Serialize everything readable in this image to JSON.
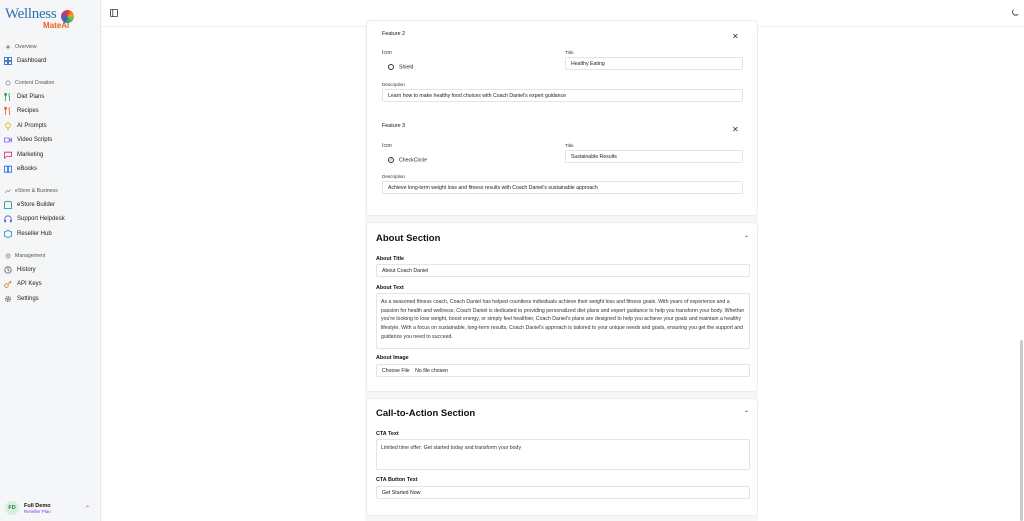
{
  "brand": {
    "name_top": "Wellness",
    "name_bottom": "MateAI"
  },
  "sidebar": {
    "sections": [
      {
        "label": "Overview",
        "items": [
          {
            "label": "Dashboard",
            "icon": "dashboard-icon",
            "color": "#2b6fb5"
          }
        ]
      },
      {
        "label": "Content Creation",
        "items": [
          {
            "label": "Diet Plans",
            "icon": "utensils-icon",
            "color": "#2ea043"
          },
          {
            "label": "Recipes",
            "icon": "chef-icon",
            "color": "#e8641b"
          },
          {
            "label": "AI Prompts",
            "icon": "bulb-icon",
            "color": "#e0b000"
          },
          {
            "label": "Video Scripts",
            "icon": "video-icon",
            "color": "#8b5cf6"
          },
          {
            "label": "Marketing",
            "icon": "message-icon",
            "color": "#db2777"
          },
          {
            "label": "eBooks",
            "icon": "book-icon",
            "color": "#2563eb"
          }
        ]
      },
      {
        "label": "eStore & Business",
        "items": [
          {
            "label": "eStore Builder",
            "icon": "store-icon",
            "color": "#0d9488"
          },
          {
            "label": "Support Helpdesk",
            "icon": "headset-icon",
            "color": "#4f46e5"
          },
          {
            "label": "Reseller Hub",
            "icon": "package-icon",
            "color": "#0891b2"
          }
        ]
      },
      {
        "label": "Management",
        "items": [
          {
            "label": "History",
            "icon": "history-icon",
            "color": "#555555"
          },
          {
            "label": "API Keys",
            "icon": "key-icon",
            "color": "#d97706"
          },
          {
            "label": "Settings",
            "icon": "gear-icon",
            "color": "#555555"
          }
        ]
      }
    ],
    "user": {
      "initials": "FD",
      "name": "Full Demo",
      "plan": "Reseller Plan"
    }
  },
  "features": [
    {
      "heading": "Feature 2",
      "icon_label": "Icon",
      "icon_value": "Shield",
      "title_label": "Title",
      "title_value": "Healthy Eating",
      "desc_label": "Description",
      "desc_value": "Learn how to make healthy food choices with Coach Daniel's expert guidance"
    },
    {
      "heading": "Feature 3",
      "icon_label": "Icon",
      "icon_value": "CheckCircle",
      "title_label": "Title",
      "title_value": "Sustainable Results",
      "desc_label": "Description",
      "desc_value": "Achieve long-term weight loss and fitness results with Coach Daniel's sustainable approach"
    }
  ],
  "about": {
    "heading": "About Section",
    "title_label": "About Title",
    "title_value": "About Coach Daniel",
    "text_label": "About Text",
    "text_value": "As a seasoned fitness coach, Coach Daniel has helped countless individuals achieve their weight loss and fitness goals. With years of experience and a passion for health and wellness, Coach Daniel is dedicated to providing personalized diet plans and expert guidance to help you transform your body. Whether you're looking to lose weight, boost energy, or simply feel healthier, Coach Daniel's plans are designed to help you achieve your goals and maintain a healthy lifestyle. With a focus on sustainable, long-term results, Coach Daniel's approach is tailored to your unique needs and goals, ensuring you get the support and guidance you need to succeed.",
    "image_label": "About Image",
    "choose_file": "Choose File",
    "no_file": "No file chosen"
  },
  "cta": {
    "heading": "Call-to-Action Section",
    "text_label": "CTA Text",
    "text_value": "Limited time offer: Get started today and transform your body",
    "button_label": "CTA Button Text",
    "button_value": "Get Started Now"
  }
}
